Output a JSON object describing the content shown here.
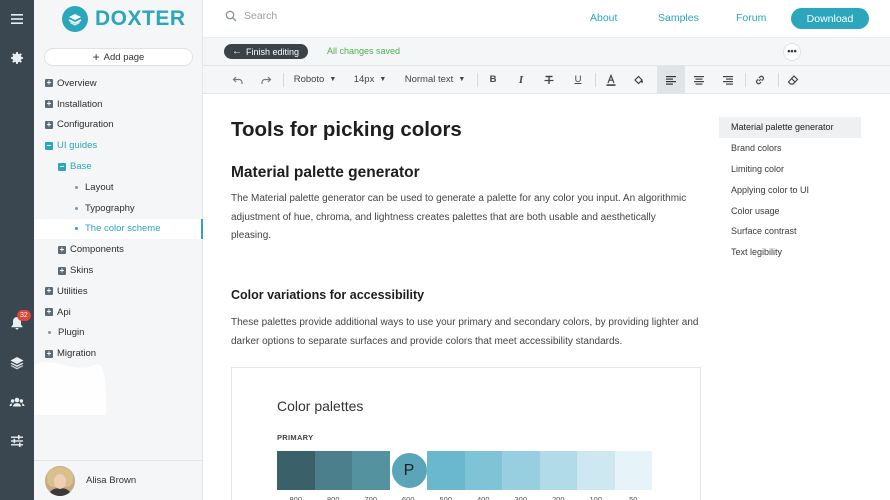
{
  "brand": {
    "name": "DOXTER",
    "color": "#2ba6bd"
  },
  "rail": {
    "notification_count": "32"
  },
  "sidebar": {
    "add_page": "Add page",
    "nav": [
      {
        "label": "Overview",
        "level": 0,
        "type": "plus"
      },
      {
        "label": "Installation",
        "level": 0,
        "type": "plus"
      },
      {
        "label": "Configuration",
        "level": 0,
        "type": "plus"
      },
      {
        "label": "UI guides",
        "level": 0,
        "type": "minus"
      },
      {
        "label": "Base",
        "level": 1,
        "type": "minus"
      },
      {
        "label": "Layout",
        "level": 2,
        "type": "dot"
      },
      {
        "label": "Typography",
        "level": 2,
        "type": "dot"
      },
      {
        "label": "The color scheme",
        "level": 2,
        "type": "dot",
        "active": true
      },
      {
        "label": "Components",
        "level": 1,
        "type": "plus"
      },
      {
        "label": "Skins",
        "level": 1,
        "type": "plus"
      },
      {
        "label": "Utilities",
        "level": 0,
        "type": "plus"
      },
      {
        "label": "Api",
        "level": 0,
        "type": "plus"
      },
      {
        "label": "Plugin",
        "level": 0,
        "type": "dot"
      },
      {
        "label": "Migration",
        "level": 0,
        "type": "plus"
      }
    ],
    "user_name": "Alisa Brown"
  },
  "topbar": {
    "search_placeholder": "Search",
    "links": [
      "About",
      "Samples",
      "Forum"
    ],
    "download": "Download"
  },
  "editbar": {
    "finish": "Finish editing",
    "status": "All changes saved",
    "more": "•••"
  },
  "toolbar": {
    "font": "Roboto",
    "size": "14px",
    "style": "Normal text",
    "bold": "B",
    "italic": "I",
    "underline": "U"
  },
  "content": {
    "title": "Tools for picking colors",
    "section1": "Material palette generator",
    "para1": "The Material palette generator can be used to generate a palette for any color you input. An algorithmic adjustment of hue, chroma, and lightness creates palettes that are both usable and aesthetically pleasing.",
    "section2": "Color variations for accessibility",
    "para2": "These palettes provide additional ways to use your primary and secondary colors, by providing lighter and darker options to separate surfaces and provide colors that meet accessibility standards.",
    "card_title": "Color palettes",
    "card_subtitle": "PRIMARY",
    "primary_letter": "P",
    "swatches": [
      {
        "label": "900",
        "color": "#3a6169"
      },
      {
        "label": "800",
        "color": "#4a7f8b"
      },
      {
        "label": "700",
        "color": "#5492a0"
      },
      {
        "label": "600",
        "color": "#5aa6b8",
        "primary": true
      },
      {
        "label": "500",
        "color": "#6ab8cd"
      },
      {
        "label": "400",
        "color": "#7fc3d6"
      },
      {
        "label": "300",
        "color": "#98cfe0"
      },
      {
        "label": "200",
        "color": "#b1dbe8"
      },
      {
        "label": "100",
        "color": "#cde8f1"
      },
      {
        "label": "50",
        "color": "#e6f4f9"
      }
    ]
  },
  "toc": [
    {
      "label": "Material palette generator",
      "active": true
    },
    {
      "label": "Brand colors"
    },
    {
      "label": "Limiting color"
    },
    {
      "label": "Applying color to UI"
    },
    {
      "label": "Color usage"
    },
    {
      "label": "Surface contrast"
    },
    {
      "label": "Text legibility"
    }
  ]
}
